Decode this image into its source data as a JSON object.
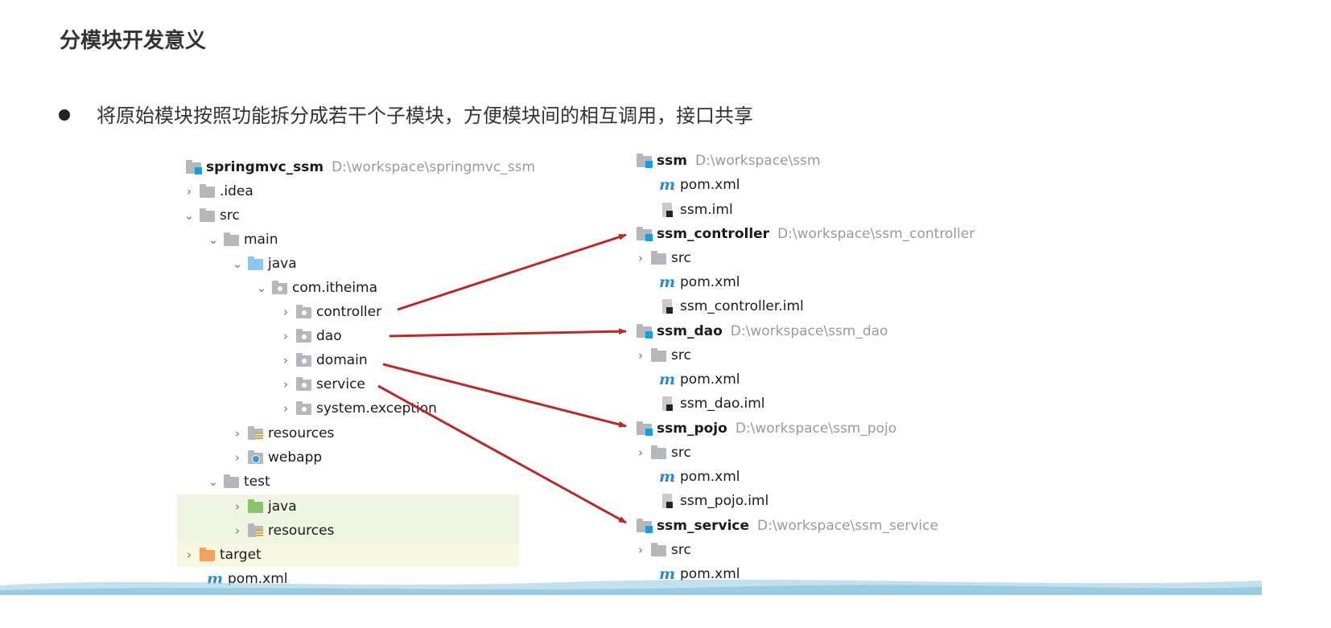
{
  "title": "分模块开发意义",
  "bullet": "将原始模块按照功能拆分成若干个子模块，方便模块间的相互调用，接口共享",
  "left_tree": {
    "root": {
      "name": "springmvc_ssm",
      "path": "D:\\workspace\\springmvc_ssm"
    },
    "idea": ".idea",
    "src": "src",
    "main": "main",
    "java": "java",
    "package": "com.itheima",
    "controller": "controller",
    "dao": "dao",
    "domain": "domain",
    "service": "service",
    "system_exception": "system.exception",
    "resources": "resources",
    "webapp": "webapp",
    "test": "test",
    "test_java": "java",
    "test_resources": "resources",
    "target": "target",
    "pom": "pom.xml"
  },
  "right_tree": {
    "ssm": {
      "name": "ssm",
      "path": "D:\\workspace\\ssm",
      "pom": "pom.xml",
      "iml": "ssm.iml"
    },
    "ssm_controller": {
      "name": "ssm_controller",
      "path": "D:\\workspace\\ssm_controller",
      "src": "src",
      "pom": "pom.xml",
      "iml": "ssm_controller.iml"
    },
    "ssm_dao": {
      "name": "ssm_dao",
      "path": "D:\\workspace\\ssm_dao",
      "src": "src",
      "pom": "pom.xml",
      "iml": "ssm_dao.iml"
    },
    "ssm_pojo": {
      "name": "ssm_pojo",
      "path": "D:\\workspace\\ssm_pojo",
      "src": "src",
      "pom": "pom.xml",
      "iml": "ssm_pojo.iml"
    },
    "ssm_service": {
      "name": "ssm_service",
      "path": "D:\\workspace\\ssm_service",
      "src": "src",
      "pom": "pom.xml"
    }
  },
  "colors": {
    "arrow": "#b52b27",
    "test_highlight": "#eef5e3",
    "target_highlight": "#f8f8e2"
  }
}
